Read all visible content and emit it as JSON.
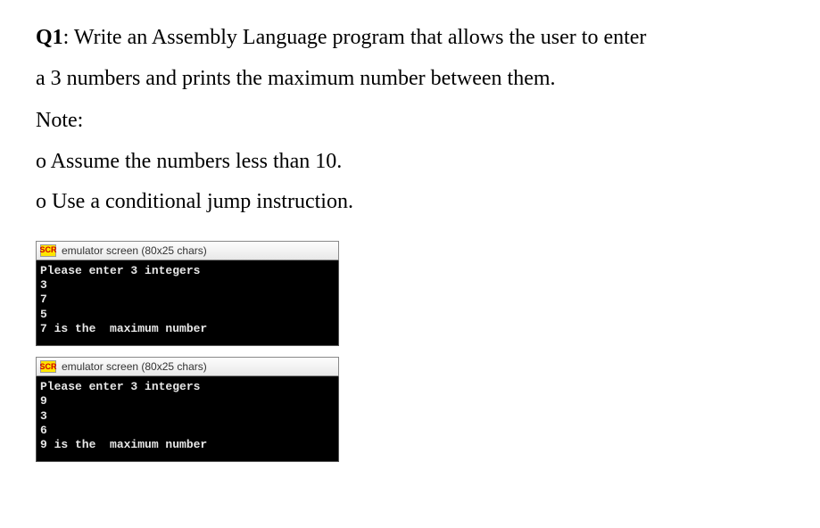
{
  "question": {
    "label": "Q1",
    "text_part1": ": Write an Assembly Language program that allows the user to enter",
    "text_part2": "a 3 numbers and prints the maximum number between them.",
    "note_label": "Note:",
    "bullet1": "o Assume the numbers less than 10.",
    "bullet2": "o Use a conditional jump instruction."
  },
  "emulator1": {
    "icon_text": "SCR",
    "title": "emulator screen (80x25 chars)",
    "lines": {
      "l0": "Please enter 3 integers",
      "l1": "3",
      "l2": "7",
      "l3": "5",
      "l4": "7 is the  maximum number"
    }
  },
  "emulator2": {
    "icon_text": "SCR",
    "title": "emulator screen (80x25 chars)",
    "lines": {
      "l0": "Please enter 3 integers",
      "l1": "9",
      "l2": "3",
      "l3": "6",
      "l4": "9 is the  maximum number"
    }
  }
}
